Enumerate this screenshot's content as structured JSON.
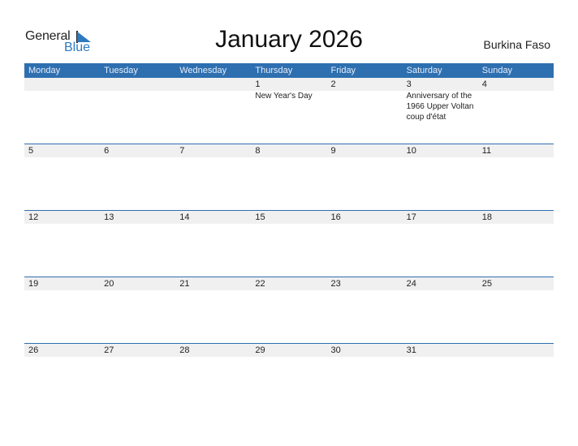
{
  "logo": {
    "word1": "General",
    "word2": "Blue"
  },
  "title": "January 2026",
  "country": "Burkina Faso",
  "colors": {
    "header": "#2e6fb0",
    "accent": "#2e7ac1",
    "band": "#f0f0f0"
  },
  "weekdays": [
    "Monday",
    "Tuesday",
    "Wednesday",
    "Thursday",
    "Friday",
    "Saturday",
    "Sunday"
  ],
  "weeks": [
    [
      {
        "day": "",
        "event": ""
      },
      {
        "day": "",
        "event": ""
      },
      {
        "day": "",
        "event": ""
      },
      {
        "day": "1",
        "event": "New Year's Day"
      },
      {
        "day": "2",
        "event": ""
      },
      {
        "day": "3",
        "event": "Anniversary of the 1966 Upper Voltan coup d'état"
      },
      {
        "day": "4",
        "event": ""
      }
    ],
    [
      {
        "day": "5",
        "event": ""
      },
      {
        "day": "6",
        "event": ""
      },
      {
        "day": "7",
        "event": ""
      },
      {
        "day": "8",
        "event": ""
      },
      {
        "day": "9",
        "event": ""
      },
      {
        "day": "10",
        "event": ""
      },
      {
        "day": "11",
        "event": ""
      }
    ],
    [
      {
        "day": "12",
        "event": ""
      },
      {
        "day": "13",
        "event": ""
      },
      {
        "day": "14",
        "event": ""
      },
      {
        "day": "15",
        "event": ""
      },
      {
        "day": "16",
        "event": ""
      },
      {
        "day": "17",
        "event": ""
      },
      {
        "day": "18",
        "event": ""
      }
    ],
    [
      {
        "day": "19",
        "event": ""
      },
      {
        "day": "20",
        "event": ""
      },
      {
        "day": "21",
        "event": ""
      },
      {
        "day": "22",
        "event": ""
      },
      {
        "day": "23",
        "event": ""
      },
      {
        "day": "24",
        "event": ""
      },
      {
        "day": "25",
        "event": ""
      }
    ],
    [
      {
        "day": "26",
        "event": ""
      },
      {
        "day": "27",
        "event": ""
      },
      {
        "day": "28",
        "event": ""
      },
      {
        "day": "29",
        "event": ""
      },
      {
        "day": "30",
        "event": ""
      },
      {
        "day": "31",
        "event": ""
      },
      {
        "day": "",
        "event": ""
      }
    ]
  ]
}
